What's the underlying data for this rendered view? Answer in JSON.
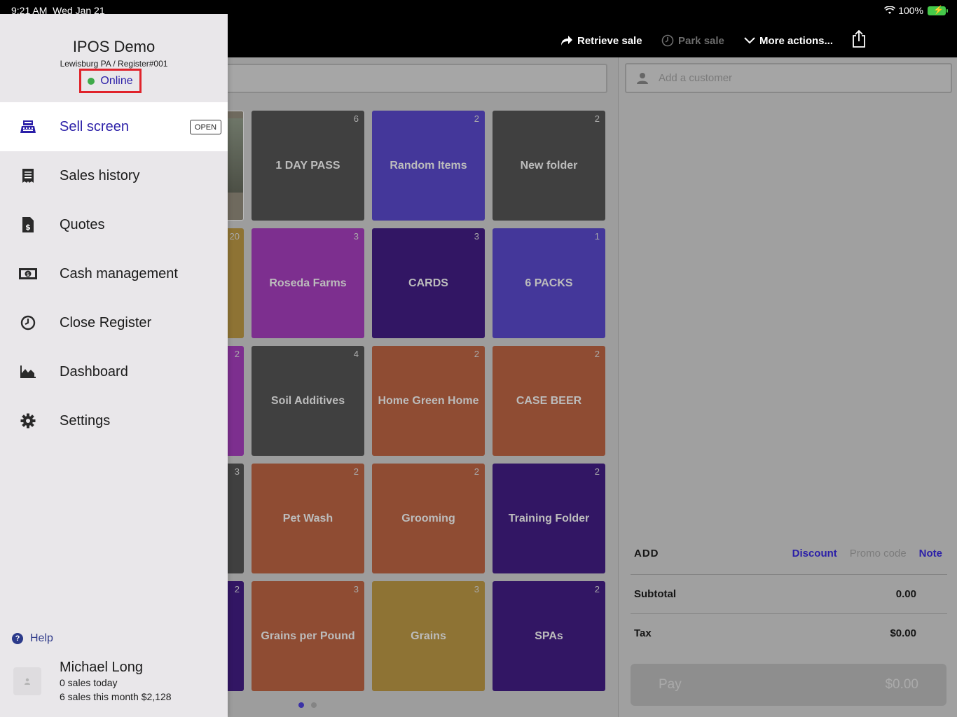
{
  "status_bar": {
    "time": "9:21 AM",
    "date": "Wed Jan 21",
    "battery": "100%"
  },
  "toolbar": {
    "retrieve_label": "Retrieve sale",
    "park_label": "Park sale",
    "more_label": "More actions..."
  },
  "drawer": {
    "store_name": "IPOS Demo",
    "store_location": "Lewisburg PA / Register#001",
    "connection_status": "Online",
    "nav": [
      {
        "label": "Sell screen",
        "icon": "register-icon",
        "badge": "OPEN"
      },
      {
        "label": "Sales history",
        "icon": "receipt-icon"
      },
      {
        "label": "Quotes",
        "icon": "quote-document-icon"
      },
      {
        "label": "Cash management",
        "icon": "cash-icon"
      },
      {
        "label": "Close Register",
        "icon": "clock-icon"
      },
      {
        "label": "Dashboard",
        "icon": "chart-icon"
      },
      {
        "label": "Settings",
        "icon": "gear-icon"
      }
    ],
    "help_label": "Help",
    "user": {
      "name": "Michael Long",
      "sales_today": "0 sales today",
      "sales_month": "6 sales this month $2,128"
    }
  },
  "tiles": [
    {
      "label": "1 DAY PASS",
      "count": "6",
      "color": "dark"
    },
    {
      "label": "Random Items",
      "count": "2",
      "color": "blue"
    },
    {
      "label": "New folder",
      "count": "2",
      "color": "dark"
    },
    {
      "label": "Roseda Farms",
      "count": "3",
      "color": "purple"
    },
    {
      "label": "CARDS",
      "count": "3",
      "color": "navy"
    },
    {
      "label": "6 PACKS",
      "count": "1",
      "color": "blue"
    },
    {
      "label": "Soil Additives",
      "count": "4",
      "color": "dark"
    },
    {
      "label": "Home Green Home",
      "count": "2",
      "color": "rust"
    },
    {
      "label": "CASE BEER",
      "count": "2",
      "color": "rust"
    },
    {
      "label": "Pet Wash",
      "count": "2",
      "color": "rust"
    },
    {
      "label": "Grooming",
      "count": "2",
      "color": "rust"
    },
    {
      "label": "Training Folder",
      "count": "2",
      "color": "navy"
    },
    {
      "label": "Grains per Pound",
      "count": "3",
      "color": "rust"
    },
    {
      "label": "Grains",
      "count": "3",
      "color": "gold"
    },
    {
      "label": "SPAs",
      "count": "2",
      "color": "navy"
    }
  ],
  "left_column_counts": [
    "20",
    "2",
    "3",
    "2"
  ],
  "cart": {
    "customer_placeholder": "Add a customer",
    "add_label": "ADD",
    "discount_label": "Discount",
    "promo_label": "Promo code",
    "note_label": "Note",
    "subtotal_label": "Subtotal",
    "subtotal_value": "0.00",
    "tax_label": "Tax",
    "tax_value": "$0.00",
    "pay_label": "Pay",
    "pay_value": "$0.00"
  },
  "colors": {
    "accent": "#2b1fa8",
    "online_highlight": "#e0232b",
    "online_dot": "#3faa4a"
  }
}
